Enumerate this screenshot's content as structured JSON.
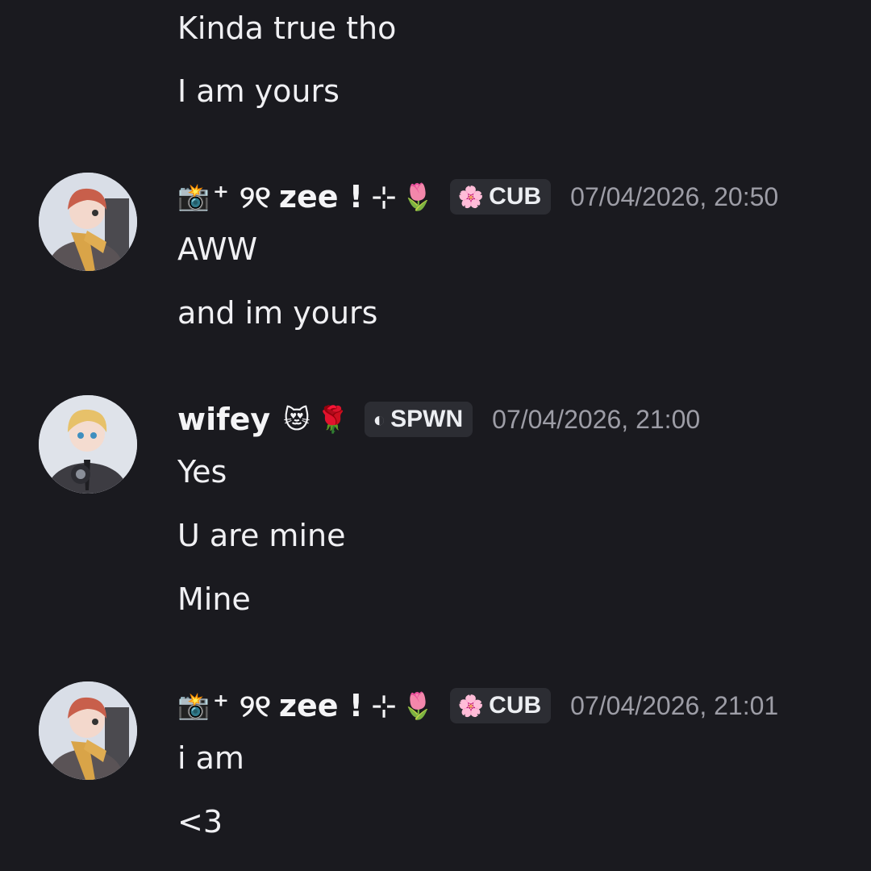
{
  "messages_top": [
    {
      "text": "Kinda true tho"
    },
    {
      "text": "I am yours"
    }
  ],
  "groups": [
    {
      "author": {
        "camera_emoji": "📸",
        "prefix": "⁺ ୨୧",
        "name": "zee !",
        "suffix": "⊹",
        "flower_emoji": "🌷"
      },
      "tag": {
        "icon": "🌸",
        "label": "CUB"
      },
      "timestamp": "07/04/2026, 20:50",
      "messages": [
        "AWW",
        "and im yours"
      ]
    },
    {
      "author": {
        "name": "wifey",
        "emoji1": "😻",
        "emoji2": "🌹"
      },
      "tag": {
        "icon": "◐",
        "label": "SPWN"
      },
      "timestamp": "07/04/2026, 21:00",
      "messages": [
        "Yes",
        "U are mine",
        "Mine"
      ]
    },
    {
      "author": {
        "camera_emoji": "📸",
        "prefix": "⁺ ୨୧",
        "name": "zee !",
        "suffix": "⊹",
        "flower_emoji": "🌷"
      },
      "tag": {
        "icon": "🌸",
        "label": "CUB"
      },
      "timestamp": "07/04/2026, 21:01",
      "messages": [
        "i am",
        "<3"
      ]
    }
  ],
  "colors": {
    "background": "#1a1a1f",
    "text": "#f0f0f3",
    "timestamp": "#9d9da6",
    "tag_bg": "#2c2d33"
  }
}
